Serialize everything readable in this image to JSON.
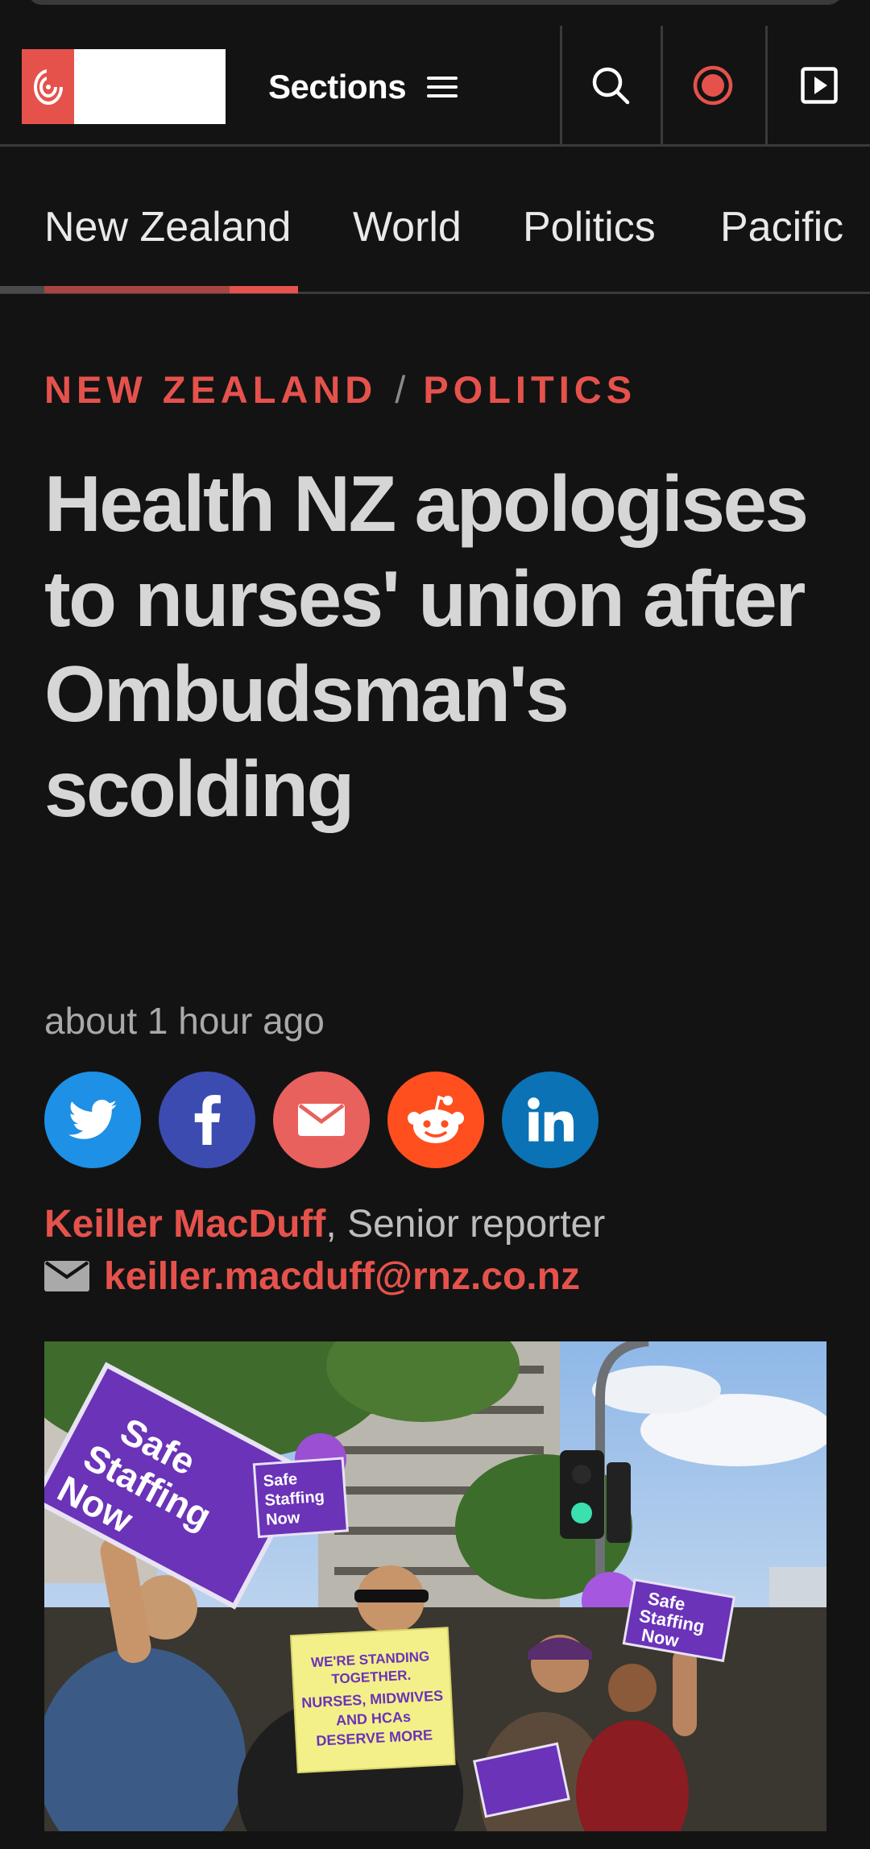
{
  "header": {
    "sections_label": "Sections",
    "accent_color": "#e5524c"
  },
  "tabs": [
    {
      "label": "New Zealand",
      "active": true
    },
    {
      "label": "World",
      "active": false
    },
    {
      "label": "Politics",
      "active": false
    },
    {
      "label": "Pacific",
      "active": false
    }
  ],
  "article": {
    "breadcrumb": [
      "NEW ZEALAND",
      "POLITICS"
    ],
    "breadcrumb_separator": "/",
    "headline": "Health NZ apologises to nurses' union after Ombudsman's scolding",
    "timestamp": "about 1 hour ago",
    "share": [
      {
        "network": "twitter",
        "icon": "twitter-icon",
        "color": "#1e90e5"
      },
      {
        "network": "facebook",
        "icon": "facebook-icon",
        "color": "#3b4bb0"
      },
      {
        "network": "email",
        "icon": "envelope-icon",
        "color": "#e8615c"
      },
      {
        "network": "reddit",
        "icon": "reddit-icon",
        "color": "#ff4f1f"
      },
      {
        "network": "linkedin",
        "icon": "linkedin-icon",
        "color": "#0a72b5"
      }
    ],
    "author_name": "Keiller MacDuff",
    "author_role": ", Senior reporter",
    "author_email": "keiller.macduff@rnz.co.nz",
    "photo": {
      "sign_safe_staffing": [
        "Safe",
        "Staffing",
        "Now"
      ],
      "sign_yellow": [
        "WE'RE STANDING",
        "TOGETHER.",
        "NURSES, MIDWIVES",
        "AND HCAs",
        "DESERVE MORE"
      ]
    }
  }
}
